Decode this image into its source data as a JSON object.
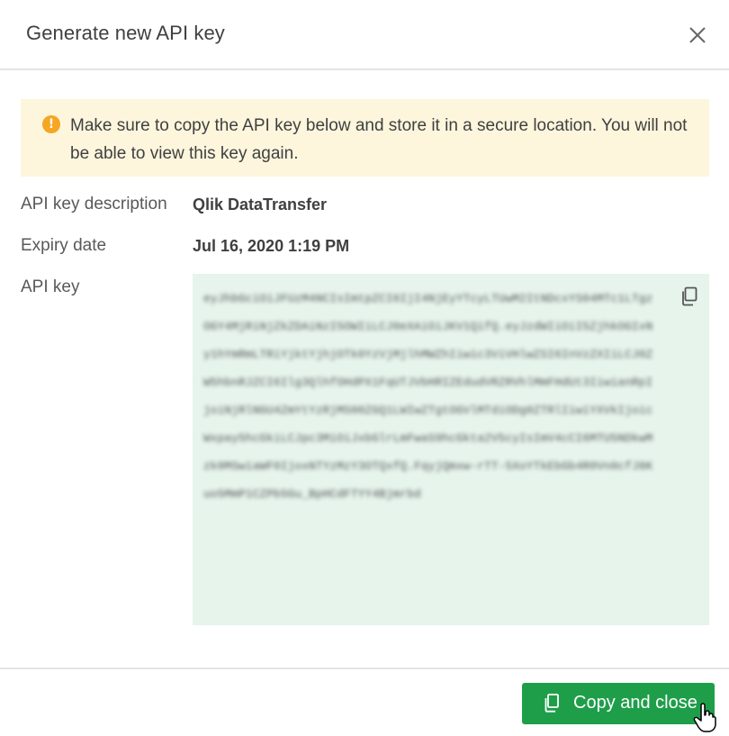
{
  "dialog": {
    "title": "Generate new API key",
    "close_icon": "close-icon"
  },
  "warning": {
    "icon": "warning-icon",
    "icon_glyph": "!",
    "message": "Make sure to copy the API key below and store it in a secure location. You will not be able to view this key again.",
    "color": "#f5a623",
    "background": "#fdf6dd"
  },
  "fields": {
    "description_label": "API key description",
    "description_value": "Qlik DataTransfer",
    "expiry_label": "Expiry date",
    "expiry_value": "Jul 16, 2020 1:19 PM",
    "key_label": "API key",
    "key_value": "eyJhbGciOiJFUzM4NCIsImtpZCI6IjI4NjEyYTcyLTUwM2ItNDcxYS04MTc1LTgzOGY4MjRiNjZkZDAiNzI5OWIiLCJ0eXAiOiJKV1QifQ.eyJzdWIiOiI5ZjhkOGIxNy1hYmRmLTRiYjktYjhjOTk0YzVjMjlhMWZhIiwic3ViVHlwZSI6InVzZXIiLCJ0ZW5hbnRJZCI6Ilg3QlhfOHdPX1FqUTJVbHRIZEdudVRZRVhlMmFHdUt3IiwianRpIjoiNjRlNGU4ZmYtYzRjMS00ZGQ1LWIwZTgtOGVlMTdiODg0ZTRlIiwiYXVkIjoicWxpay5hcGkiLCJpc3MiOiJxbGlrLmFwaS9hcGkta2V5cyIsImV4cCI6MTU5NDkwMzk0MSwiaWF0IjoxNTYzMzY3OTQxfQ.FqyjQmxw-rTT-5XoYTkEbGb4R0Vn0cfJ8Kuo5MmP1CZPb5Gu_BpHCdFTYY4Bjmrbd",
    "key_background": "#e6f4ec",
    "copy_icon": "copy-icon"
  },
  "footer": {
    "copy_close_label": "Copy and close",
    "button_color": "#1f9e4a",
    "button_icon": "copy-icon"
  }
}
